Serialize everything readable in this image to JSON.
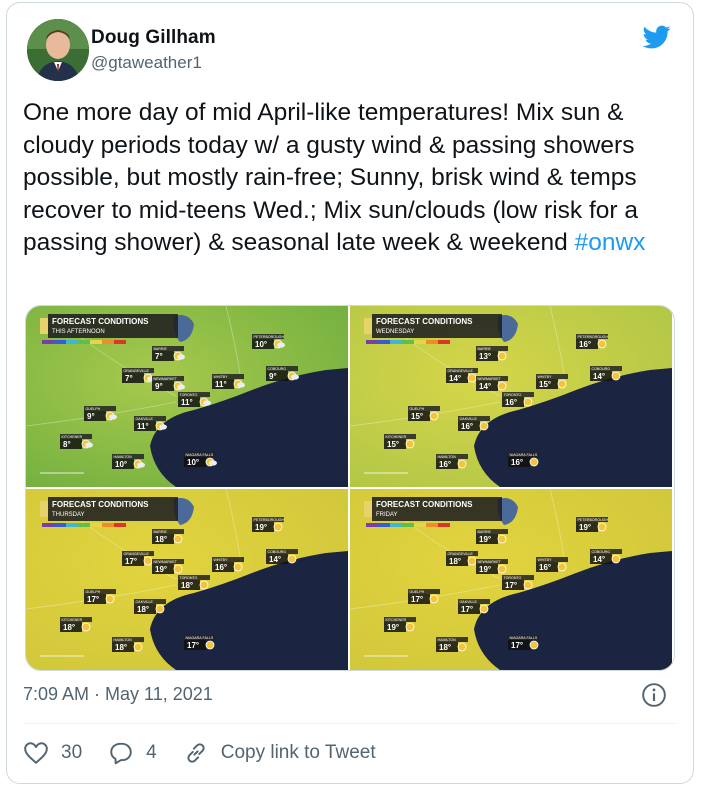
{
  "author": {
    "name": "Doug Gillham",
    "handle": "@gtaweather1"
  },
  "tweet": {
    "text": "One more day of mid April-like temperatures! Mix sun & cloudy periods today w/ a gusty wind & passing showers possible, but mostly rain-free; Sunny, brisk wind & temps recover to mid-teens Wed.; Mix sun/clouds (low risk for a passing shower) & seasonal late week & weekend ",
    "hashtag": "#onwx",
    "timestamp": "7:09 AM · May 11, 2021"
  },
  "actions": {
    "likes": "30",
    "replies": "4",
    "copy_link": "Copy link to Tweet"
  },
  "colors": {
    "link": "#1d9bf0",
    "muted": "#536471",
    "twitter_blue": "#1d9bf0"
  },
  "maps": [
    {
      "title": "FORECAST CONDITIONS",
      "period": "THIS AFTERNOON",
      "palette": "green",
      "cities": [
        {
          "name": "PETERBOROUGH",
          "temp": "10°"
        },
        {
          "name": "BARRIE",
          "temp": "7°"
        },
        {
          "name": "ORANGEVILLE",
          "temp": "7°"
        },
        {
          "name": "NEWMARKET",
          "temp": "9°"
        },
        {
          "name": "WHITBY",
          "temp": "11°"
        },
        {
          "name": "COBOURG",
          "temp": "9°"
        },
        {
          "name": "TORONTO",
          "temp": "11°"
        },
        {
          "name": "GUELPH",
          "temp": "9°"
        },
        {
          "name": "OAKVILLE",
          "temp": "11°"
        },
        {
          "name": "KITCHENER",
          "temp": "8°"
        },
        {
          "name": "HAMILTON",
          "temp": "10°"
        },
        {
          "name": "NIAGARA FALLS",
          "temp": "10°"
        }
      ]
    },
    {
      "title": "FORECAST CONDITIONS",
      "period": "WEDNESDAY",
      "palette": "yellowgreen",
      "cities": [
        {
          "name": "PETERBOROUGH",
          "temp": "16°"
        },
        {
          "name": "BARRIE",
          "temp": "13°"
        },
        {
          "name": "ORANGEVILLE",
          "temp": "14°"
        },
        {
          "name": "NEWMARKET",
          "temp": "14°"
        },
        {
          "name": "WHITBY",
          "temp": "15°"
        },
        {
          "name": "COBOURG",
          "temp": "14°"
        },
        {
          "name": "TORONTO",
          "temp": "16°"
        },
        {
          "name": "GUELPH",
          "temp": "15°"
        },
        {
          "name": "OAKVILLE",
          "temp": "16°"
        },
        {
          "name": "KITCHENER",
          "temp": "15°"
        },
        {
          "name": "HAMILTON",
          "temp": "16°"
        },
        {
          "name": "NIAGARA FALLS",
          "temp": "16°"
        }
      ]
    },
    {
      "title": "FORECAST CONDITIONS",
      "period": "THURSDAY",
      "palette": "yellow",
      "cities": [
        {
          "name": "PETERBOROUGH",
          "temp": "19°"
        },
        {
          "name": "BARRIE",
          "temp": "18°"
        },
        {
          "name": "ORANGEVILLE",
          "temp": "17°"
        },
        {
          "name": "NEWMARKET",
          "temp": "19°"
        },
        {
          "name": "WHITBY",
          "temp": "16°"
        },
        {
          "name": "COBOURG",
          "temp": "14°"
        },
        {
          "name": "TORONTO",
          "temp": "18°"
        },
        {
          "name": "GUELPH",
          "temp": "17°"
        },
        {
          "name": "OAKVILLE",
          "temp": "18°"
        },
        {
          "name": "KITCHENER",
          "temp": "18°"
        },
        {
          "name": "HAMILTON",
          "temp": "18°"
        },
        {
          "name": "NIAGARA FALLS",
          "temp": "17°"
        }
      ]
    },
    {
      "title": "FORECAST CONDITIONS",
      "period": "FRIDAY",
      "palette": "yellow",
      "cities": [
        {
          "name": "PETERBOROUGH",
          "temp": "19°"
        },
        {
          "name": "BARRIE",
          "temp": "19°"
        },
        {
          "name": "ORANGEVILLE",
          "temp": "18°"
        },
        {
          "name": "NEWMARKET",
          "temp": "19°"
        },
        {
          "name": "WHITBY",
          "temp": "16°"
        },
        {
          "name": "COBOURG",
          "temp": "14°"
        },
        {
          "name": "TORONTO",
          "temp": "17°"
        },
        {
          "name": "GUELPH",
          "temp": "17°"
        },
        {
          "name": "OAKVILLE",
          "temp": "17°"
        },
        {
          "name": "KITCHENER",
          "temp": "19°"
        },
        {
          "name": "HAMILTON",
          "temp": "18°"
        },
        {
          "name": "NIAGARA FALLS",
          "temp": "17°"
        }
      ]
    }
  ],
  "icons": {
    "bird": "twitter-bird-icon",
    "info": "info-icon",
    "like": "heart-icon",
    "reply": "reply-icon",
    "link": "link-icon"
  }
}
